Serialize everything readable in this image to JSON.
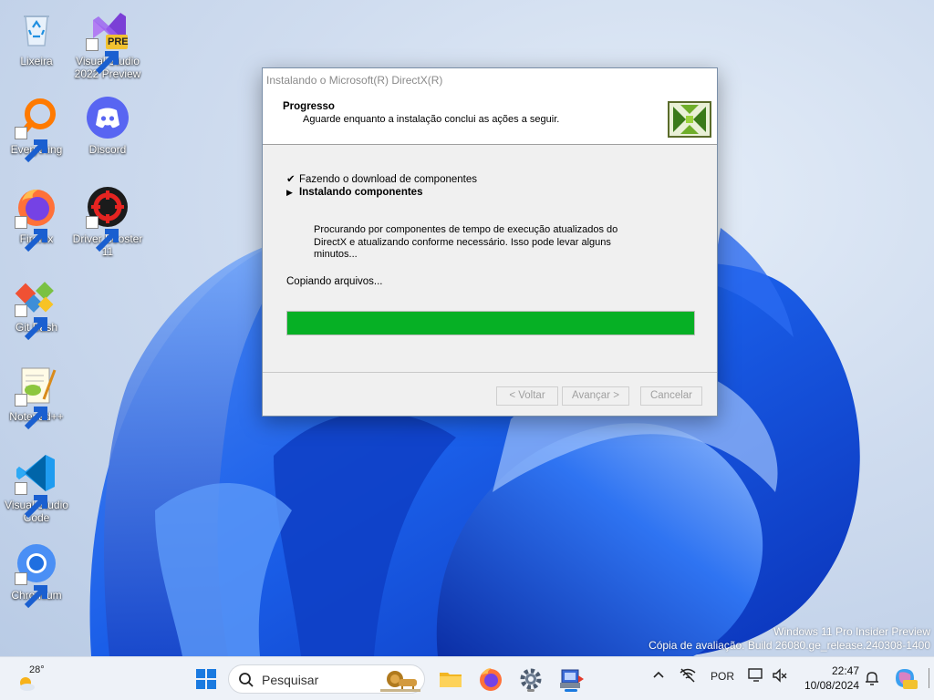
{
  "desktop": {
    "icons": [
      {
        "label": "Lixeira",
        "icon": "recycle-bin-icon"
      },
      {
        "label": "Visual Studio 2022 Preview",
        "icon": "visual-studio-preview-icon",
        "badge": "PRE"
      },
      {
        "label": "Everything",
        "icon": "everything-search-icon"
      },
      {
        "label": "Discord",
        "icon": "discord-icon"
      },
      {
        "label": "Firefox",
        "icon": "firefox-icon"
      },
      {
        "label": "Driver Booster 11",
        "icon": "driver-booster-icon"
      },
      {
        "label": "Git Bash",
        "icon": "git-bash-icon"
      },
      {
        "label": "Notepad++",
        "icon": "notepad-plus-plus-icon"
      },
      {
        "label": "Visual Studio Code",
        "icon": "vscode-icon"
      },
      {
        "label": "Chromium",
        "icon": "chromium-icon"
      }
    ]
  },
  "dialog": {
    "title": "Instalando o Microsoft(R) DirectX(R)",
    "header_title": "Progresso",
    "header_subtitle": "Aguarde enquanto a instalação conclui as ações a seguir.",
    "logo_icon": "directx-logo-icon",
    "steps": [
      {
        "mark": "✔",
        "label": "Fazendo o download de componentes",
        "state": "done"
      },
      {
        "mark": "▶",
        "label": "Instalando componentes",
        "state": "current"
      }
    ],
    "info": "Procurando por componentes de tempo de execução atualizados do DirectX e atualizando conforme necessário. Isso pode levar alguns minutos...",
    "status": "Copiando arquivos...",
    "progress_percent": 100,
    "progress_color": "#06b025",
    "buttons": {
      "back": "< Voltar",
      "next": "Avançar >",
      "cancel": "Cancelar"
    }
  },
  "watermark": {
    "line1": "Windows 11 Pro Insider Preview",
    "line2": "Cópia de avaliação. Build 26080.ge_release.240308-1400"
  },
  "taskbar": {
    "weather_temp": "28°",
    "search_placeholder": "Pesquisar",
    "language": "POR",
    "time": "22:47",
    "date": "10/08/2024"
  }
}
